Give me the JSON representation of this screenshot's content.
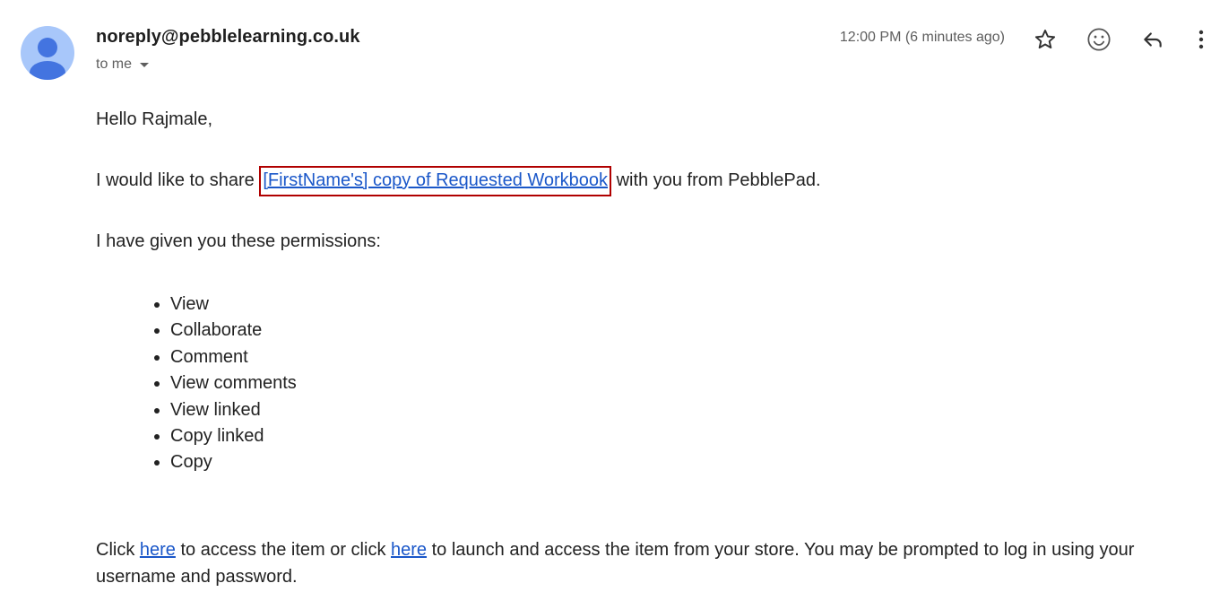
{
  "header": {
    "sender_email": "noreply@pebblelearning.co.uk",
    "recipient_label": "to me",
    "timestamp": "12:00 PM (6 minutes ago)",
    "icons": [
      "avatar-icon",
      "star-icon",
      "emoji-icon",
      "reply-icon",
      "more-vert-icon"
    ]
  },
  "body": {
    "greeting": "Hello Rajmale,",
    "share_prefix": "I would like to share ",
    "share_link": "[FirstName's] copy of Requested Workbook",
    "share_suffix": " with you from PebblePad.",
    "permissions_intro": "I have given you these permissions:",
    "permissions": [
      "View",
      "Collaborate",
      "Comment",
      "View comments",
      "View linked",
      "Copy linked",
      "Copy"
    ],
    "footer_part1": "Click ",
    "footer_link1": "here",
    "footer_part2": " to access the item or click ",
    "footer_link2": "here",
    "footer_part3": " to launch and access the item from your store. You may be prompted to log in using your username and password."
  },
  "colors": {
    "link": "#1a57c9",
    "highlight_border": "#b00000",
    "avatar_bg": "#a8c7fa",
    "avatar_fg": "#4374e0"
  }
}
